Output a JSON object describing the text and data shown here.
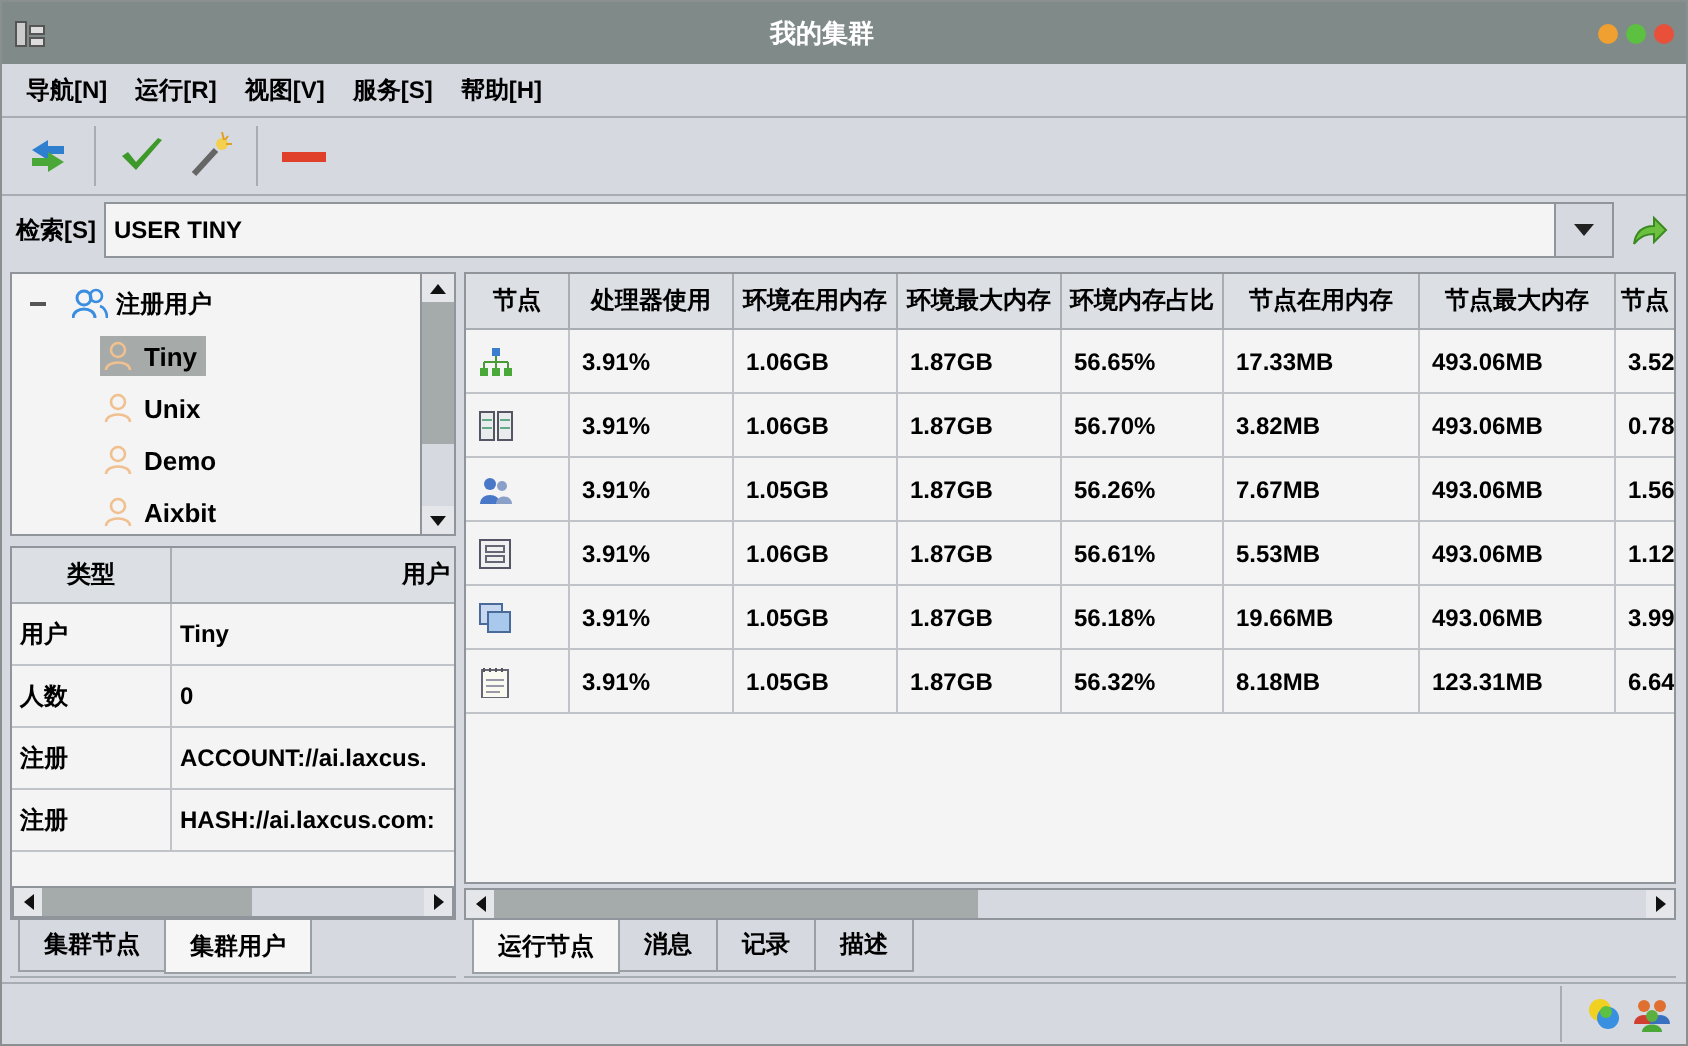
{
  "window": {
    "title": "我的集群"
  },
  "menu": [
    {
      "label": "导航[N]"
    },
    {
      "label": "运行[R]"
    },
    {
      "label": "视图[V]"
    },
    {
      "label": "服务[S]"
    },
    {
      "label": "帮助[H]"
    }
  ],
  "search": {
    "label": "检索[S]",
    "value": "USER TINY"
  },
  "tree": {
    "label": "注册用户",
    "expanded": true,
    "children": [
      {
        "label": "Tiny",
        "selected": true
      },
      {
        "label": "Unix",
        "selected": false
      },
      {
        "label": "Demo",
        "selected": false
      },
      {
        "label": "Aixbit",
        "selected": false
      }
    ]
  },
  "properties": {
    "columns": [
      "类型",
      "用户"
    ],
    "rows": [
      [
        "用户",
        "Tiny"
      ],
      [
        "人数",
        "0"
      ],
      [
        "注册",
        "ACCOUNT://ai.laxcus."
      ],
      [
        "注册",
        "HASH://ai.laxcus.com:"
      ]
    ]
  },
  "left_tabs": [
    {
      "label": "集群节点",
      "selected": false
    },
    {
      "label": "集群用户",
      "selected": true
    }
  ],
  "nodes": {
    "columns": [
      "节点",
      "处理器使用",
      "环境在用内存",
      "环境最大内存",
      "环境内存占比",
      "节点在用内存",
      "节点最大内存",
      "节点"
    ],
    "rows": [
      {
        "kind": "network",
        "cells": [
          "",
          "3.91%",
          "1.06GB",
          "1.87GB",
          "56.65%",
          "17.33MB",
          "493.06MB",
          "3.52"
        ]
      },
      {
        "kind": "server",
        "cells": [
          "",
          "3.91%",
          "1.06GB",
          "1.87GB",
          "56.70%",
          "3.82MB",
          "493.06MB",
          "0.78"
        ]
      },
      {
        "kind": "users",
        "cells": [
          "",
          "3.91%",
          "1.05GB",
          "1.87GB",
          "56.26%",
          "7.67MB",
          "493.06MB",
          "1.56"
        ]
      },
      {
        "kind": "window",
        "cells": [
          "",
          "3.91%",
          "1.06GB",
          "1.87GB",
          "56.61%",
          "5.53MB",
          "493.06MB",
          "1.12"
        ]
      },
      {
        "kind": "windows",
        "cells": [
          "",
          "3.91%",
          "1.05GB",
          "1.87GB",
          "56.18%",
          "19.66MB",
          "493.06MB",
          "3.99"
        ]
      },
      {
        "kind": "notepad",
        "cells": [
          "",
          "3.91%",
          "1.05GB",
          "1.87GB",
          "56.32%",
          "8.18MB",
          "123.31MB",
          "6.64"
        ]
      }
    ]
  },
  "right_tabs": [
    {
      "label": "运行节点",
      "selected": true
    },
    {
      "label": "消息",
      "selected": false
    },
    {
      "label": "记录",
      "selected": false
    },
    {
      "label": "描述",
      "selected": false
    }
  ]
}
